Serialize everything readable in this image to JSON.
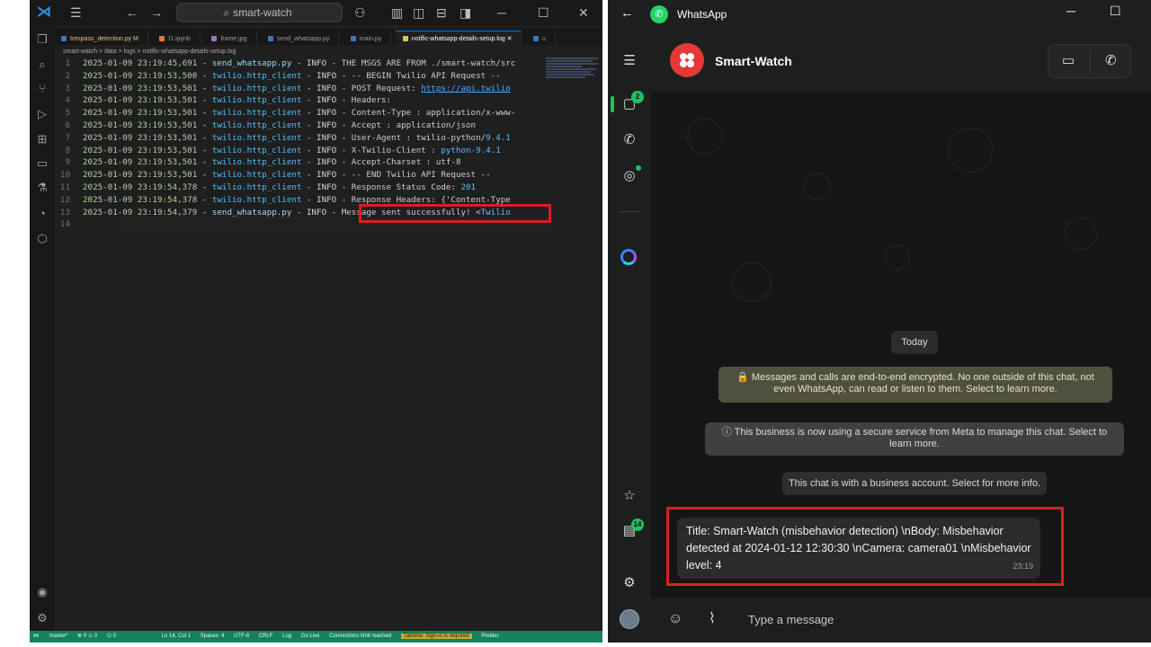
{
  "vscode": {
    "search": "smart-watch",
    "tabs": [
      {
        "label": "trespass_detection.py M",
        "mod": true
      },
      {
        "label": "t1.ipynb",
        "mod": false
      },
      {
        "label": "frame.jpg",
        "mod": false
      },
      {
        "label": "send_whatsapp.py",
        "mod": false
      },
      {
        "label": "main.py",
        "mod": false
      },
      {
        "label": "notific-whatsapp-details-setup.log",
        "active": true
      },
      {
        "label": "u",
        "mod": false
      }
    ],
    "breadcrumb": "smart-watch  >  data  >  logs  >  notific-whatsapp-details-setup.log",
    "lines": [
      {
        "n": "1",
        "ts": "2025-01-09 23:19:45,691",
        "src": "send_whatsapp.py",
        "lvl": "INFO",
        "msg": "THE MSGS ARE FROM ./smart-watch/src"
      },
      {
        "n": "2",
        "ts": "2025-01-09 23:19:53,500",
        "src": "twilio.http_client",
        "lvl": "INFO",
        "msg": "-- BEGIN Twilio API Request --"
      },
      {
        "n": "3",
        "ts": "2025-01-09 23:19:53,501",
        "src": "twilio.http_client",
        "lvl": "INFO",
        "msg": "POST Request: ",
        "link": "https://api.twilio"
      },
      {
        "n": "4",
        "ts": "2025-01-09 23:19:53,501",
        "src": "twilio.http_client",
        "lvl": "INFO",
        "msg": "Headers:"
      },
      {
        "n": "5",
        "ts": "2025-01-09 23:19:53,501",
        "src": "twilio.http_client",
        "lvl": "INFO",
        "msg": "Content-Type : application/x-www-"
      },
      {
        "n": "6",
        "ts": "2025-01-09 23:19:53,501",
        "src": "twilio.http_client",
        "lvl": "INFO",
        "msg": "Accept : application/json"
      },
      {
        "n": "7",
        "ts": "2025-01-09 23:19:53,501",
        "src": "twilio.http_client",
        "lvl": "INFO",
        "msg": "User-Agent : twilio-python/",
        "num": "9.4.1"
      },
      {
        "n": "8",
        "ts": "2025-01-09 23:19:53,501",
        "src": "twilio.http_client",
        "lvl": "INFO",
        "msg": "X-Twilio-Client : ",
        "num": "python-9.4.1"
      },
      {
        "n": "9",
        "ts": "2025-01-09 23:19:53,501",
        "src": "twilio.http_client",
        "lvl": "INFO",
        "msg": "Accept-Charset : utf-8"
      },
      {
        "n": "10",
        "ts": "2025-01-09 23:19:53,501",
        "src": "twilio.http_client",
        "lvl": "INFO",
        "msg": "-- END Twilio API Request --"
      },
      {
        "n": "11",
        "ts": "2025-01-09 23:19:54,378",
        "src": "twilio.http_client",
        "lvl": "INFO",
        "msg": "Response Status Code: ",
        "num": "201"
      },
      {
        "n": "12",
        "ts": "2025-01-09 23:19:54,378",
        "src": "twilio.http_client",
        "lvl": "INFO",
        "msg": "Response Headers: {'Content-Type"
      },
      {
        "n": "13",
        "ts": "2025-01-09 23:19:54,379",
        "src": "send_whatsapp.py",
        "lvl": "INFO",
        "msg": "Message sent successfully! <",
        "num": "Twilio"
      },
      {
        "n": "14",
        "ts": "",
        "src": "",
        "lvl": "",
        "msg": ""
      }
    ],
    "status": {
      "branch": "master*",
      "problems": "⊗ 0 ⚠ 0",
      "ports": "⌬ 0",
      "position": "Ln 14, Col 1",
      "spaces": "Spaces: 4",
      "encoding": "UTF-8",
      "eol": "CRLF",
      "lang": "Log",
      "golive": "Go Live",
      "connections": "Connections limit reached",
      "tabnine": "Tabnine: Sign-in is required",
      "prettier": "Prettier"
    }
  },
  "whatsapp": {
    "app_title": "WhatsApp",
    "rail": {
      "chats_badge": "2",
      "archive_badge": "14"
    },
    "chat_name": "Smart-Watch",
    "date_divider": "Today",
    "system_messages": [
      "🔒 Messages and calls are end-to-end encrypted. No one outside of this chat, not even WhatsApp, can read or listen to them. Select to learn more.",
      "ⓘ This business is now using a secure service from Meta to manage this chat. Select to learn more.",
      "This chat is with a business account. Select for more info."
    ],
    "message": {
      "text": "Title: Smart-Watch (misbehavior detection) \\nBody: Misbehavior detected at 2024-01-12 12:30:30 \\nCamera: camera01 \\nMisbehavior level: 4",
      "time": "23:19"
    },
    "composer_placeholder": "Type a message",
    "colors": {
      "accent": "#21c063",
      "highlight": "#e01b24"
    }
  }
}
